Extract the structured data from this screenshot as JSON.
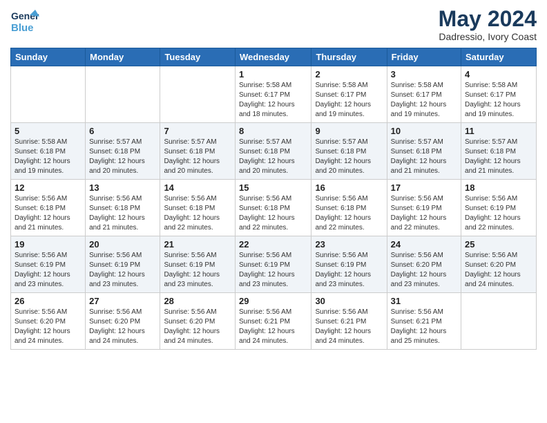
{
  "header": {
    "logo_general": "General",
    "logo_blue": "Blue",
    "month": "May 2024",
    "location": "Dadressio, Ivory Coast"
  },
  "weekdays": [
    "Sunday",
    "Monday",
    "Tuesday",
    "Wednesday",
    "Thursday",
    "Friday",
    "Saturday"
  ],
  "weeks": [
    [
      {
        "day": "",
        "info": ""
      },
      {
        "day": "",
        "info": ""
      },
      {
        "day": "",
        "info": ""
      },
      {
        "day": "1",
        "info": "Sunrise: 5:58 AM\nSunset: 6:17 PM\nDaylight: 12 hours\nand 18 minutes."
      },
      {
        "day": "2",
        "info": "Sunrise: 5:58 AM\nSunset: 6:17 PM\nDaylight: 12 hours\nand 19 minutes."
      },
      {
        "day": "3",
        "info": "Sunrise: 5:58 AM\nSunset: 6:17 PM\nDaylight: 12 hours\nand 19 minutes."
      },
      {
        "day": "4",
        "info": "Sunrise: 5:58 AM\nSunset: 6:17 PM\nDaylight: 12 hours\nand 19 minutes."
      }
    ],
    [
      {
        "day": "5",
        "info": "Sunrise: 5:58 AM\nSunset: 6:18 PM\nDaylight: 12 hours\nand 19 minutes."
      },
      {
        "day": "6",
        "info": "Sunrise: 5:57 AM\nSunset: 6:18 PM\nDaylight: 12 hours\nand 20 minutes."
      },
      {
        "day": "7",
        "info": "Sunrise: 5:57 AM\nSunset: 6:18 PM\nDaylight: 12 hours\nand 20 minutes."
      },
      {
        "day": "8",
        "info": "Sunrise: 5:57 AM\nSunset: 6:18 PM\nDaylight: 12 hours\nand 20 minutes."
      },
      {
        "day": "9",
        "info": "Sunrise: 5:57 AM\nSunset: 6:18 PM\nDaylight: 12 hours\nand 20 minutes."
      },
      {
        "day": "10",
        "info": "Sunrise: 5:57 AM\nSunset: 6:18 PM\nDaylight: 12 hours\nand 21 minutes."
      },
      {
        "day": "11",
        "info": "Sunrise: 5:57 AM\nSunset: 6:18 PM\nDaylight: 12 hours\nand 21 minutes."
      }
    ],
    [
      {
        "day": "12",
        "info": "Sunrise: 5:56 AM\nSunset: 6:18 PM\nDaylight: 12 hours\nand 21 minutes."
      },
      {
        "day": "13",
        "info": "Sunrise: 5:56 AM\nSunset: 6:18 PM\nDaylight: 12 hours\nand 21 minutes."
      },
      {
        "day": "14",
        "info": "Sunrise: 5:56 AM\nSunset: 6:18 PM\nDaylight: 12 hours\nand 22 minutes."
      },
      {
        "day": "15",
        "info": "Sunrise: 5:56 AM\nSunset: 6:18 PM\nDaylight: 12 hours\nand 22 minutes."
      },
      {
        "day": "16",
        "info": "Sunrise: 5:56 AM\nSunset: 6:18 PM\nDaylight: 12 hours\nand 22 minutes."
      },
      {
        "day": "17",
        "info": "Sunrise: 5:56 AM\nSunset: 6:19 PM\nDaylight: 12 hours\nand 22 minutes."
      },
      {
        "day": "18",
        "info": "Sunrise: 5:56 AM\nSunset: 6:19 PM\nDaylight: 12 hours\nand 22 minutes."
      }
    ],
    [
      {
        "day": "19",
        "info": "Sunrise: 5:56 AM\nSunset: 6:19 PM\nDaylight: 12 hours\nand 23 minutes."
      },
      {
        "day": "20",
        "info": "Sunrise: 5:56 AM\nSunset: 6:19 PM\nDaylight: 12 hours\nand 23 minutes."
      },
      {
        "day": "21",
        "info": "Sunrise: 5:56 AM\nSunset: 6:19 PM\nDaylight: 12 hours\nand 23 minutes."
      },
      {
        "day": "22",
        "info": "Sunrise: 5:56 AM\nSunset: 6:19 PM\nDaylight: 12 hours\nand 23 minutes."
      },
      {
        "day": "23",
        "info": "Sunrise: 5:56 AM\nSunset: 6:19 PM\nDaylight: 12 hours\nand 23 minutes."
      },
      {
        "day": "24",
        "info": "Sunrise: 5:56 AM\nSunset: 6:20 PM\nDaylight: 12 hours\nand 23 minutes."
      },
      {
        "day": "25",
        "info": "Sunrise: 5:56 AM\nSunset: 6:20 PM\nDaylight: 12 hours\nand 24 minutes."
      }
    ],
    [
      {
        "day": "26",
        "info": "Sunrise: 5:56 AM\nSunset: 6:20 PM\nDaylight: 12 hours\nand 24 minutes."
      },
      {
        "day": "27",
        "info": "Sunrise: 5:56 AM\nSunset: 6:20 PM\nDaylight: 12 hours\nand 24 minutes."
      },
      {
        "day": "28",
        "info": "Sunrise: 5:56 AM\nSunset: 6:20 PM\nDaylight: 12 hours\nand 24 minutes."
      },
      {
        "day": "29",
        "info": "Sunrise: 5:56 AM\nSunset: 6:21 PM\nDaylight: 12 hours\nand 24 minutes."
      },
      {
        "day": "30",
        "info": "Sunrise: 5:56 AM\nSunset: 6:21 PM\nDaylight: 12 hours\nand 24 minutes."
      },
      {
        "day": "31",
        "info": "Sunrise: 5:56 AM\nSunset: 6:21 PM\nDaylight: 12 hours\nand 25 minutes."
      },
      {
        "day": "",
        "info": ""
      }
    ]
  ]
}
